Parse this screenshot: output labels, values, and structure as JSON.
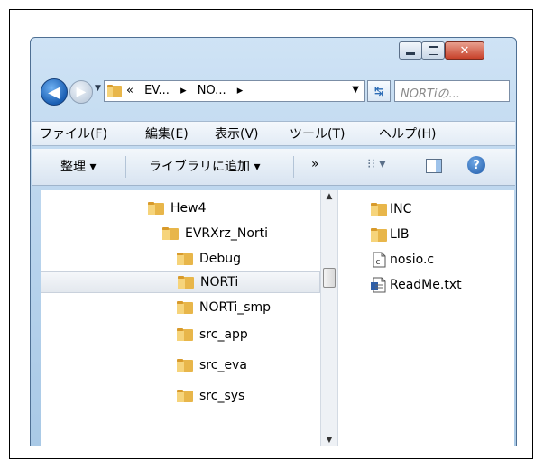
{
  "window": {
    "navigation": {
      "crumbs": [
        "«",
        "EV...",
        "▸",
        "NO...",
        "▸"
      ],
      "search_placeholder": "NORTiの..."
    },
    "menu": {
      "items": [
        "ファイル(F)",
        "編集(E)",
        "表示(V)",
        "ツール(T)",
        "ヘルプ(H)"
      ]
    },
    "toolbar": {
      "organize": "整理 ▾",
      "add_library": "ライブラリに追加 ▾",
      "more": "»",
      "view_glyph": "⁝⁝ ▾",
      "help_glyph": "?"
    },
    "tree": [
      {
        "label": "Hew4",
        "selected": false
      },
      {
        "label": "EVRXrz_Norti",
        "selected": false
      },
      {
        "label": "Debug",
        "selected": false
      },
      {
        "label": "NORTi",
        "selected": true
      },
      {
        "label": "NORTi_smp",
        "selected": false
      },
      {
        "label": "src_app",
        "selected": false
      },
      {
        "label": "src_eva",
        "selected": false
      },
      {
        "label": "src_sys",
        "selected": false
      }
    ],
    "files": [
      {
        "name": "INC",
        "icon": "folder-icon"
      },
      {
        "name": "LIB",
        "icon": "folder-icon"
      },
      {
        "name": "nosio.c",
        "icon": "c-file-icon"
      },
      {
        "name": "ReadMe.txt",
        "icon": "text-file-icon"
      }
    ],
    "colors": {
      "folder": "#e8b64a",
      "selection": "#e3e8ee",
      "accent": "#1a5fb4"
    }
  }
}
